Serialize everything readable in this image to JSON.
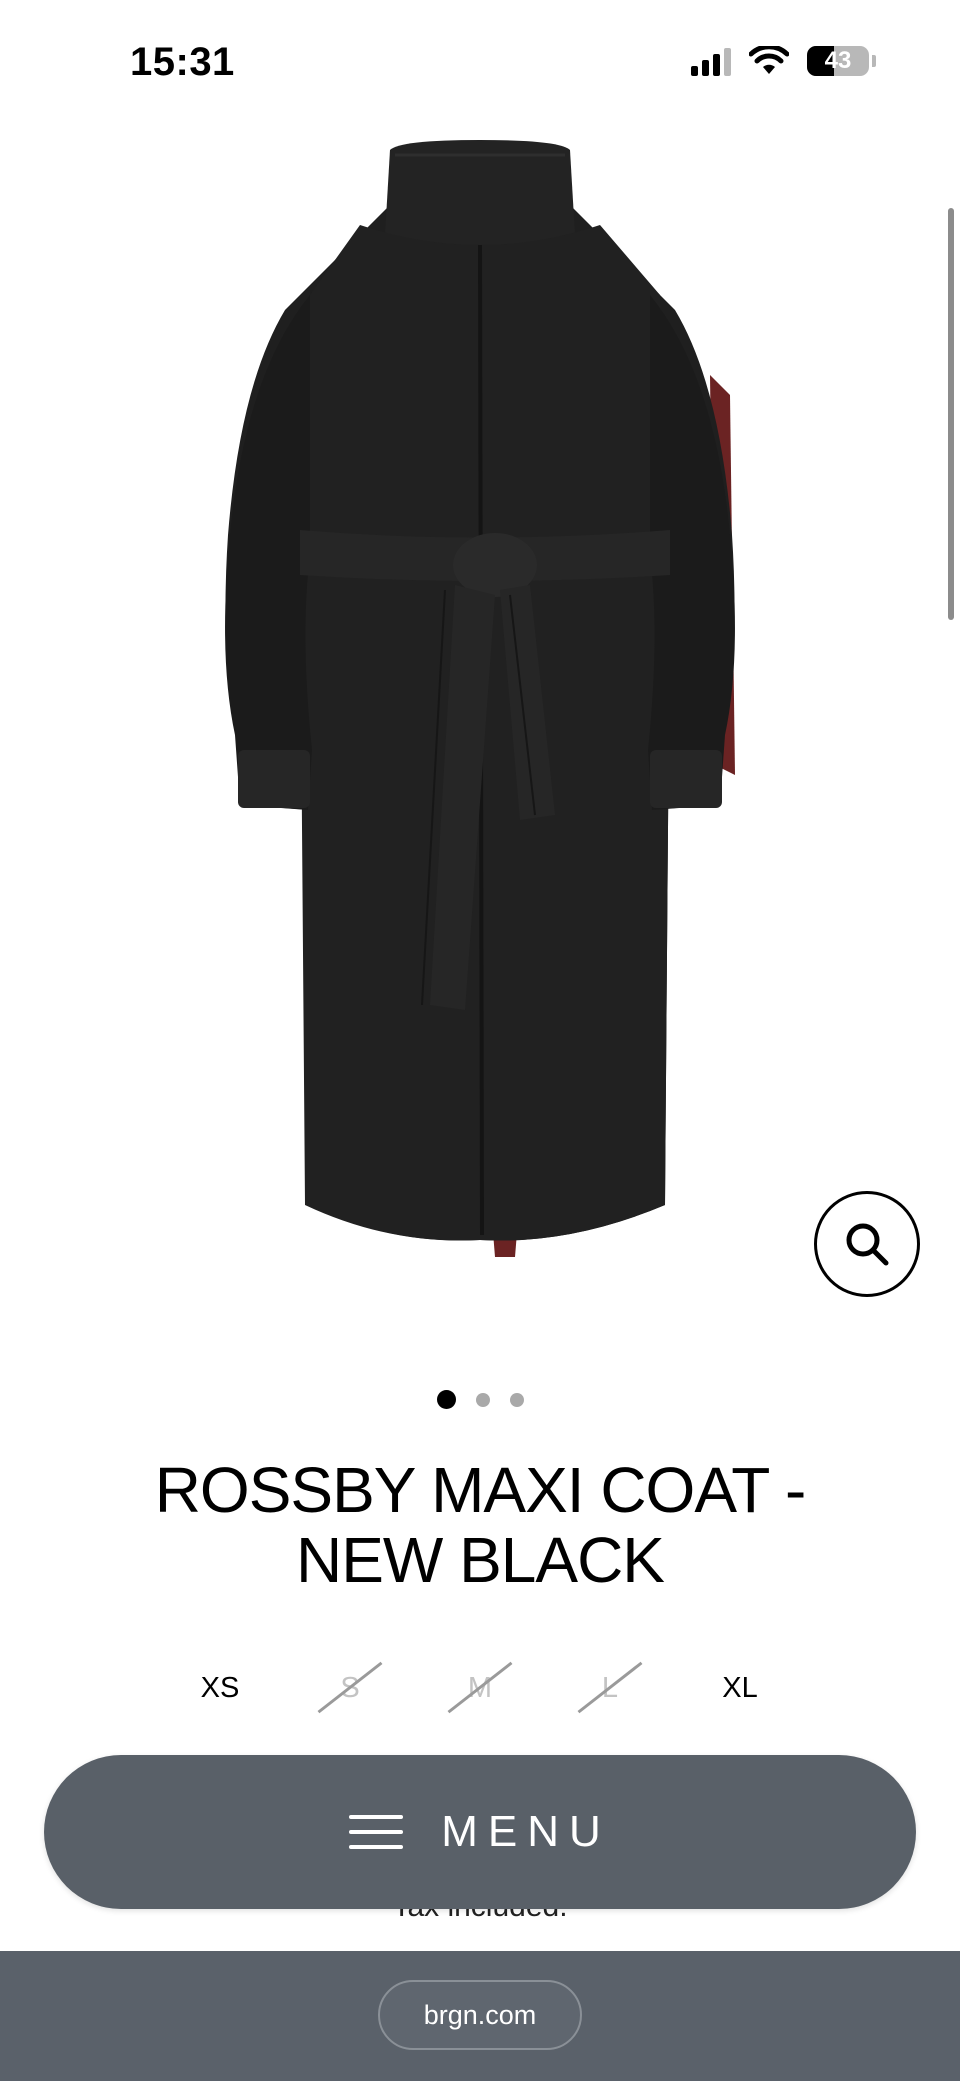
{
  "status_bar": {
    "time": "15:31",
    "battery": "43",
    "icons": [
      "signal-icon",
      "wifi-icon",
      "battery-icon"
    ]
  },
  "product": {
    "title_line1": "ROSSBY MAXI COAT -",
    "title_line2": "NEW BLACK",
    "image_icon": "coat-image",
    "gallery": {
      "total_images": 3,
      "active_index": 0
    },
    "zoom_icon": "search-icon",
    "sizes": [
      {
        "label": "XS",
        "available": true
      },
      {
        "label": "S",
        "available": false
      },
      {
        "label": "M",
        "available": false
      },
      {
        "label": "L",
        "available": false
      },
      {
        "label": "XL",
        "available": true
      }
    ],
    "tax_note": "Tax included."
  },
  "menu": {
    "label": "MENU",
    "icon": "hamburger-icon"
  },
  "browser": {
    "url": "brgn.com"
  },
  "colors": {
    "menu_bg": "#596068",
    "browser_bar_bg": "#5a616a",
    "coat": "#1f1f1f",
    "coat_lining": "#7a2a2a"
  }
}
